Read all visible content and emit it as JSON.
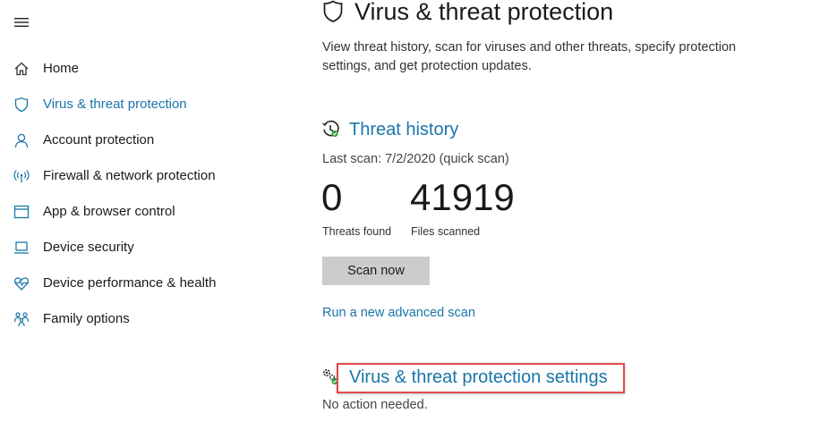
{
  "sidebar": {
    "items": [
      {
        "label": "Home",
        "icon": "home-icon"
      },
      {
        "label": "Virus & threat protection",
        "icon": "shield-icon",
        "active": true
      },
      {
        "label": "Account protection",
        "icon": "person-icon"
      },
      {
        "label": "Firewall & network protection",
        "icon": "wireless-icon"
      },
      {
        "label": "App & browser control",
        "icon": "browser-window-icon"
      },
      {
        "label": "Device security",
        "icon": "laptop-icon"
      },
      {
        "label": "Device performance & health",
        "icon": "heart-pulse-icon"
      },
      {
        "label": "Family options",
        "icon": "family-icon"
      }
    ]
  },
  "main": {
    "title": "Virus & threat protection",
    "description": "View threat history, scan for viruses and other threats, specify protection settings, and get protection updates.",
    "threat_history": {
      "title": "Threat history",
      "last_scan": "Last scan: 7/2/2020 (quick scan)",
      "threats_found_value": "0",
      "threats_found_label": "Threats found",
      "files_scanned_value": "41919",
      "files_scanned_label": "Files scanned",
      "scan_button": "Scan now",
      "advanced_link": "Run a new advanced scan"
    },
    "settings": {
      "title": "Virus & threat protection settings",
      "status": "No action needed."
    }
  },
  "colors": {
    "accent": "#1976a8",
    "highlight_border": "#e04b4b",
    "button_bg": "#cccccc",
    "status_ok": "#2e9e3e"
  }
}
